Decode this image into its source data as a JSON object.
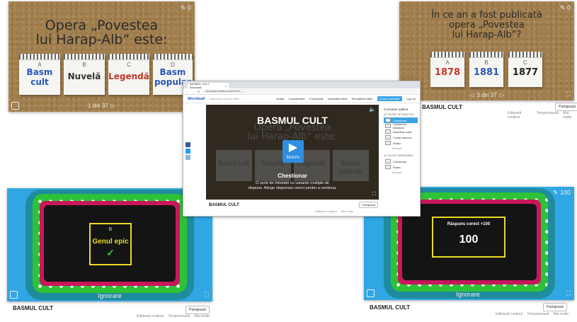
{
  "tl": {
    "question": "Opera „Povestea lui Harap-Alb” este:",
    "q_line1": "Opera „Povestea",
    "q_line2": "lui Harap-Alb” este:",
    "corner": "0",
    "pager": "1 din 37",
    "options": [
      {
        "letter": "A",
        "text1": "Basm",
        "text2": "cult",
        "color": "#2b58b5"
      },
      {
        "letter": "B",
        "text1": "Nuvelă",
        "text2": "",
        "color": "#333333"
      },
      {
        "letter": "C",
        "text1": "Legendă",
        "text2": "",
        "color": "#c0392b"
      },
      {
        "letter": "D",
        "text1": "Basm",
        "text2": "popular",
        "color": "#2b58b5"
      }
    ]
  },
  "tr": {
    "q_line1": "În ce an a fost publicată",
    "q_line2": "opera „Povestea",
    "q_line3": "lui Harap-Alb”?",
    "corner": "0",
    "pager": "3 din 37",
    "options": [
      {
        "letter": "A",
        "text": "1878",
        "color": "#c0392b"
      },
      {
        "letter": "B",
        "text": "1881",
        "color": "#2b58b5"
      },
      {
        "letter": "C",
        "text": "1877",
        "color": "#222222"
      }
    ],
    "title": "BASMUL CULT",
    "share": "Partajează",
    "sub": [
      "Editează conținut",
      "Temporizează",
      "Mai multe"
    ]
  },
  "bl": {
    "letter": "B",
    "answer": "Genul epic",
    "check": "✓",
    "ignore": "Ignorare",
    "title": "BASMUL CULT",
    "share": "Partajează",
    "sub": [
      "Editează conținut",
      "Temporizează",
      "Mai multe"
    ]
  },
  "br": {
    "score": "100",
    "result": "Răspuns corect +100",
    "big": "100",
    "ignore": "Ignorare",
    "title": "BASMUL CULT",
    "share": "Partajează",
    "sub": [
      "Editează conținut",
      "Temporizează",
      "Mai multe"
    ]
  },
  "browser": {
    "tab": "BASMUL CULT - Wordwall",
    "url": "wordwall.net/resource/3473...",
    "logo": "Wordwall",
    "nav": [
      "Acasă",
      "Caracteristici",
      "Comunitate",
      "Activitățile Mele",
      "Rezultatele Mele"
    ],
    "create": "Creare activitate",
    "login": "Log Inn",
    "search_ph": "Introduceți cuvinte cheie...",
    "game_title": "BASMUL CULT",
    "game_q1": "Opera „Povestea",
    "game_q2": "lui Harap-Alb” este:",
    "start": "ÎNCEPE",
    "bg_opts": [
      "Basm cult",
      "Nuvelă",
      "Legendă",
      "Basm popular"
    ],
    "mode_title": "Chestionar",
    "mode_desc1": "O serie de întrebări cu variante multiple de",
    "mode_desc2": "răspuns. Atinge răspunsul corect pentru a continua.",
    "below_title": "BASMUL CULT",
    "share": "Partajează",
    "sub": [
      "Editează conținut",
      "Mai multe"
    ],
    "side_head": "Comutare șablon",
    "side_sec1": "ACTIVITĂȚI INTERACTIVE",
    "side_items": [
      "Chestionar",
      "Chestionar emisiune",
      "Deschide cutia",
      "Cuvânt ascuns",
      "Roata"
    ],
    "side_more": "Afișează",
    "side_sec2": "ACTIVITĂȚI IMPRIMABILE",
    "side_print": [
      "Chestionar",
      "Roata"
    ],
    "side_more2": "Afișează"
  }
}
